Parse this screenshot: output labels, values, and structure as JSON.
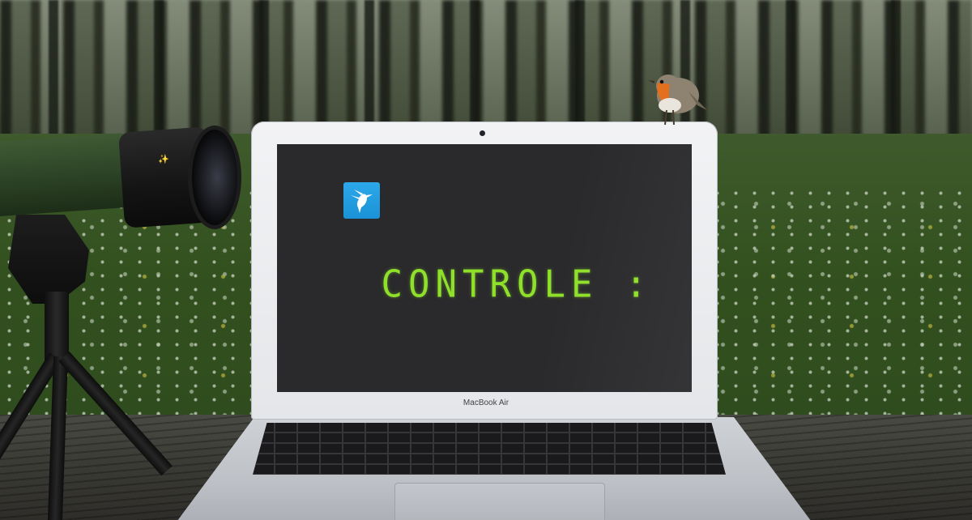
{
  "screen": {
    "heading": "CONTROLE :"
  },
  "laptop": {
    "model_label": "MacBook Air"
  },
  "app_icon": {
    "icon": "hummingbird-icon",
    "color": "#1e9be0"
  },
  "colors": {
    "heading_text": "#8fe02a",
    "screen_background": "#2a2a2c"
  }
}
